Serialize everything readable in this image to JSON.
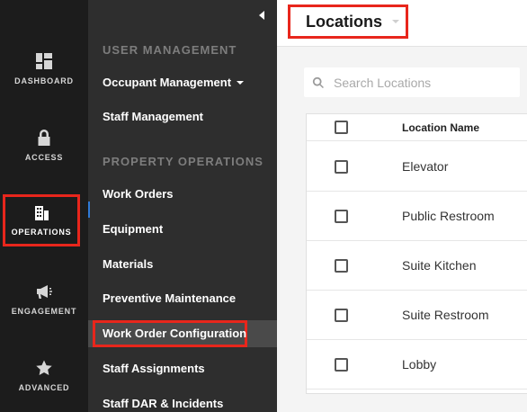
{
  "rail": {
    "items": [
      {
        "label": "DASHBOARD",
        "icon": "dashboard-icon"
      },
      {
        "label": "ACCESS",
        "icon": "lock-icon"
      },
      {
        "label": "OPERATIONS",
        "icon": "building-icon"
      },
      {
        "label": "ENGAGEMENT",
        "icon": "megaphone-icon"
      },
      {
        "label": "ADVANCED",
        "icon": "star-icon"
      }
    ],
    "active": "OPERATIONS"
  },
  "subnav": {
    "sections": [
      {
        "title": "USER MANAGEMENT",
        "items": [
          "Occupant Management",
          "Staff Management"
        ]
      },
      {
        "title": "PROPERTY OPERATIONS",
        "items": [
          "Work Orders",
          "Equipment",
          "Materials",
          "Preventive Maintenance",
          "Work Order Configuration",
          "Staff Assignments",
          "Staff DAR & Incidents"
        ]
      }
    ],
    "selected": "Work Order Configuration"
  },
  "main": {
    "title": "Locations",
    "search": {
      "placeholder": "Search Locations",
      "value": ""
    },
    "table": {
      "columns": [
        "Location Name"
      ],
      "rows": [
        "Elevator",
        "Public Restroom",
        "Suite Kitchen",
        "Suite Restroom",
        "Lobby"
      ]
    }
  },
  "colors": {
    "highlight": "#e8261c",
    "rail_bg": "#1c1c1c",
    "subnav_bg": "#2e2e2e",
    "accent": "#2f79d6"
  }
}
